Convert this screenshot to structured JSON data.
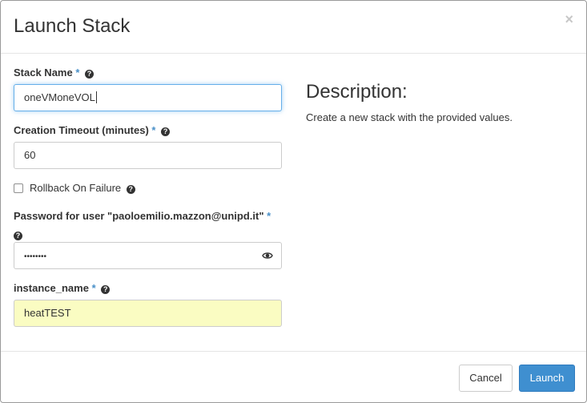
{
  "modal": {
    "title": "Launch Stack",
    "close_glyph": "×"
  },
  "form": {
    "stack_name": {
      "label": "Stack Name",
      "required_mark": "*",
      "value": "oneVMoneVOL"
    },
    "creation_timeout": {
      "label": "Creation Timeout (minutes)",
      "required_mark": "*",
      "value": "60"
    },
    "rollback": {
      "label": "Rollback On Failure",
      "checked": false
    },
    "password": {
      "label": "Password for user \"paoloemilio.mazzon@unipd.it\"",
      "required_mark": "*",
      "value": "••••••••"
    },
    "instance_name": {
      "label": "instance_name",
      "required_mark": "*",
      "value": "heatTEST"
    }
  },
  "description": {
    "title": "Description:",
    "text": "Create a new stack with the provided values."
  },
  "footer": {
    "cancel_label": "Cancel",
    "launch_label": "Launch"
  },
  "colors": {
    "primary": "#3f8fd0",
    "required": "#4a90c8",
    "autofill_bg": "#fafcc2",
    "focus_border": "#66afe9"
  },
  "icons": {
    "help": "question-circle-icon",
    "reveal": "eye-icon",
    "close": "close-icon"
  }
}
